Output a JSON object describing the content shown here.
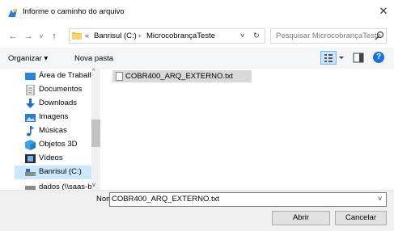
{
  "window": {
    "title": "Informe o caminho do arquivo",
    "close_label": "✕"
  },
  "nav": {
    "back": "←",
    "forward": "→",
    "history": "˅",
    "up": "↑"
  },
  "address": {
    "overflow": "«",
    "segments": [
      "Banrisul (C:)",
      "MicrocobrançaTeste"
    ],
    "separator": "›",
    "dropdown": "˅",
    "refresh": "↻"
  },
  "search": {
    "placeholder": "Pesquisar MicrocobrançaTeste"
  },
  "toolbar": {
    "organize_label": "Organizar ▾",
    "new_folder_label": "Nova pasta",
    "help_label": "?"
  },
  "sidebar": {
    "items": [
      {
        "label": "Área de Trabalho"
      },
      {
        "label": "Documentos"
      },
      {
        "label": "Downloads"
      },
      {
        "label": "Imagens"
      },
      {
        "label": "Músicas"
      },
      {
        "label": "Objetos 3D"
      },
      {
        "label": "Vídeos"
      },
      {
        "label": "Banrisul (C:)",
        "selected": true
      },
      {
        "label": "dados (\\\\saas-b"
      }
    ]
  },
  "files": [
    {
      "name": "COBR400_ARQ_EXTERNO.txt",
      "selected": true
    }
  ],
  "footer": {
    "name_label": "Nome:",
    "name_value": "COBR400_ARQ_EXTERNO.txt",
    "open_label": "Abrir",
    "cancel_label": "Cancelar"
  },
  "colors": {
    "accent": "#1a73d9",
    "selection": "#cce8ff",
    "file_selection": "#d9d9d9"
  }
}
